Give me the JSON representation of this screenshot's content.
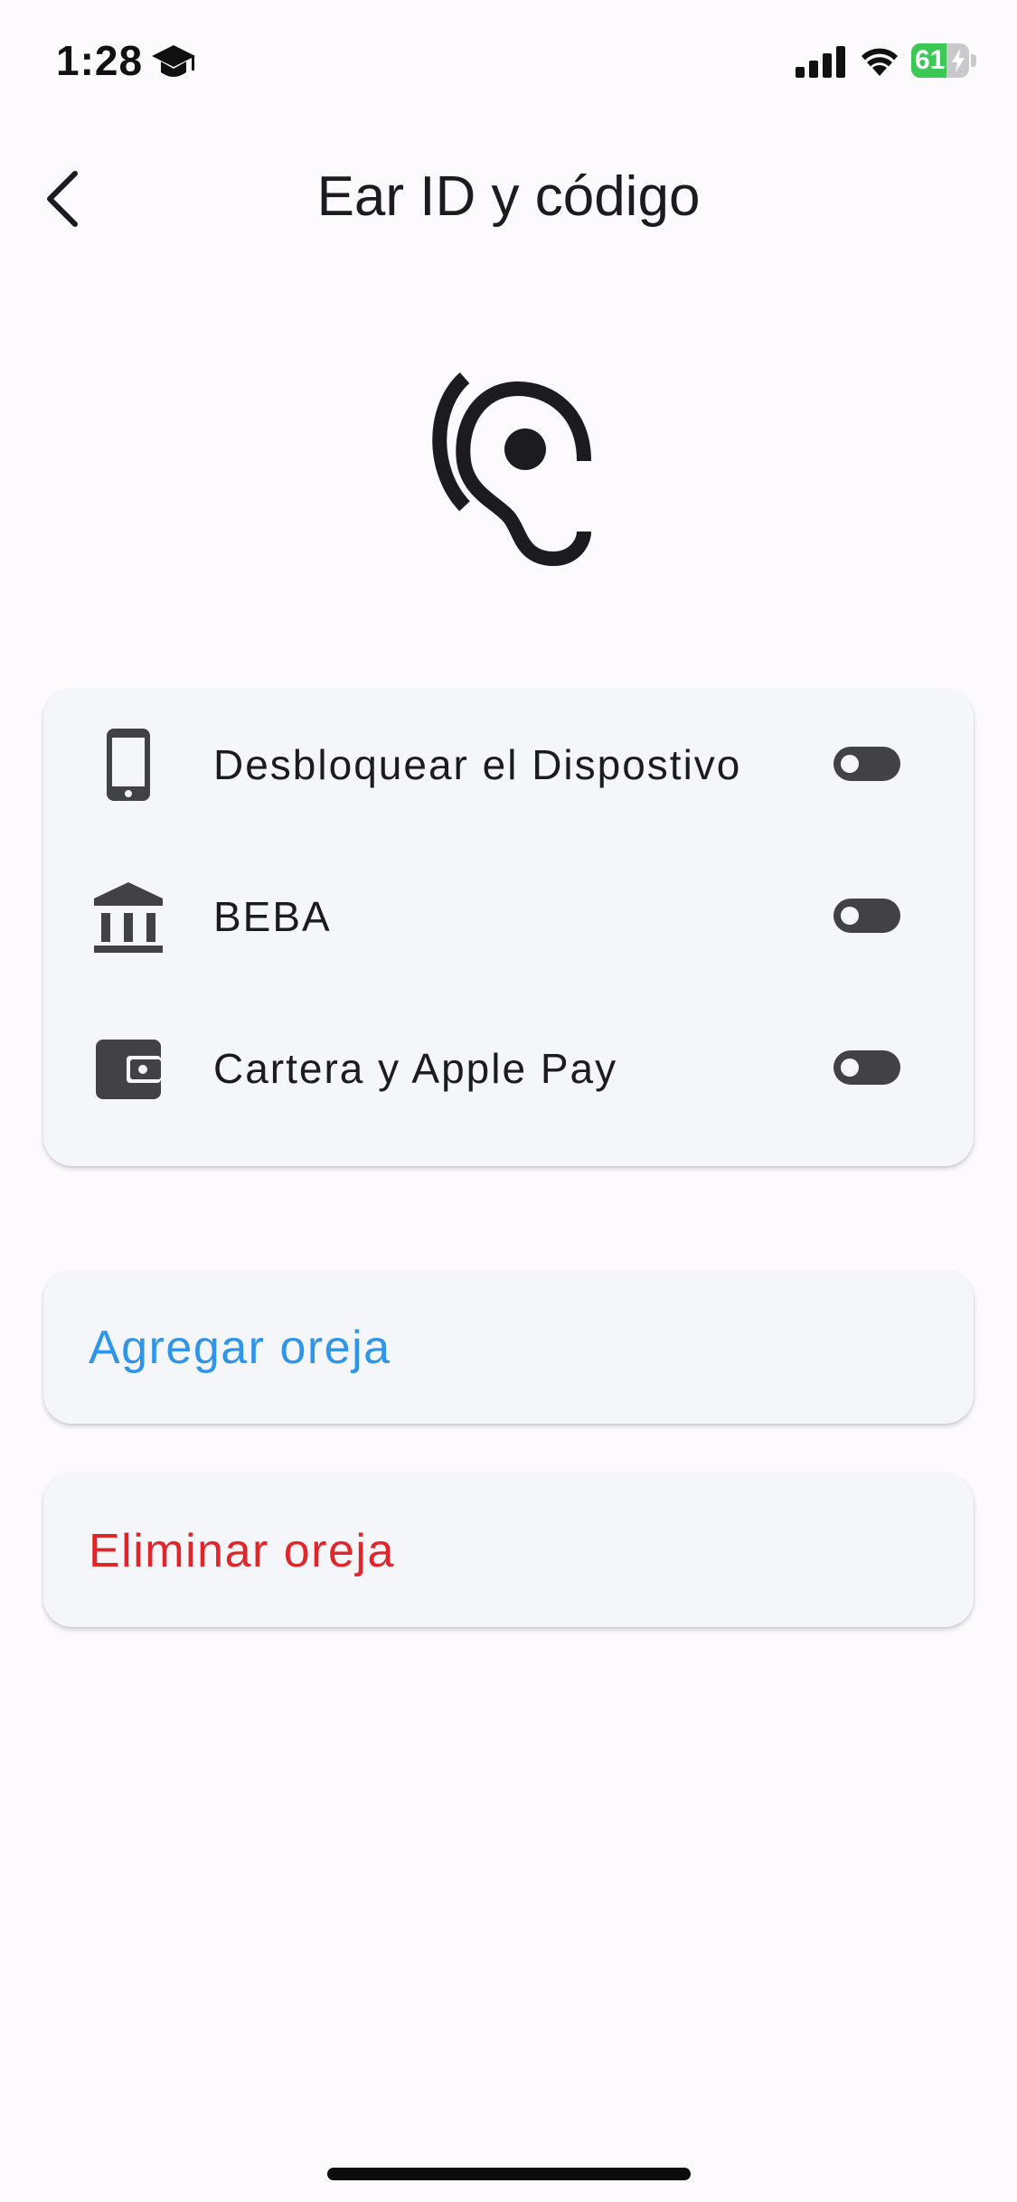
{
  "status_bar": {
    "time": "1:28",
    "battery_percent": "61",
    "battery_level": 0.61,
    "battery_color": "#3bc855"
  },
  "header": {
    "title": "Ear ID y código",
    "back_icon": "chevron-left-icon"
  },
  "hero": {
    "icon": "ear-icon"
  },
  "settings": {
    "items": [
      {
        "icon": "smartphone-icon",
        "label": "Desbloquear el Dispostivo",
        "enabled": false
      },
      {
        "icon": "bank-icon",
        "label": "BEBA",
        "enabled": false
      },
      {
        "icon": "wallet-icon",
        "label": "Cartera y Apple Pay",
        "enabled": false
      }
    ]
  },
  "actions": {
    "add_label": "Agregar oreja",
    "add_color": "#2f95e8",
    "remove_label": "Eliminar oreja",
    "remove_color": "#e0262b"
  }
}
